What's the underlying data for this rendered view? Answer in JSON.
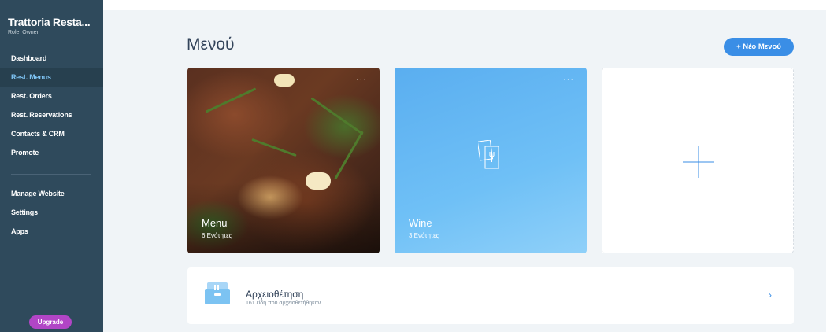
{
  "sidebar": {
    "brand_name": "Trattoria Resta...",
    "brand_role": "Role: Owner",
    "items": [
      {
        "label": "Dashboard"
      },
      {
        "label": "Rest. Menus",
        "active": true
      },
      {
        "label": "Rest. Orders"
      },
      {
        "label": "Rest. Reservations"
      },
      {
        "label": "Contacts & CRM"
      },
      {
        "label": "Promote"
      }
    ],
    "secondary_items": [
      {
        "label": "Manage Website"
      },
      {
        "label": "Settings"
      },
      {
        "label": "Apps"
      }
    ],
    "upgrade_label": "Upgrade",
    "colors": {
      "background": "#2f4a5c",
      "active_text": "#7fc4f4",
      "upgrade": "#b145c6"
    }
  },
  "main": {
    "title": "Μενού",
    "new_menu_button": "+ Νέο Μενού",
    "accent_color": "#3a8ee6",
    "cards": [
      {
        "title": "Menu",
        "subtitle": "6 Ενότητες",
        "more_icon": "more-dots-icon",
        "image": "grilled-steak-with-rosemary"
      },
      {
        "title": "Wine",
        "subtitle": "3 Ενότητες",
        "more_icon": "more-dots-icon",
        "icon": "menu-book-icon"
      },
      {
        "icon": "plus-icon"
      }
    ],
    "archive": {
      "title": "Αρχειοθέτηση",
      "subtitle": "161 είδη που αρχειοθετήθηκαν",
      "icon": "archive-box-icon",
      "chevron_icon": "chevron-right-icon",
      "chevron": "›"
    }
  }
}
